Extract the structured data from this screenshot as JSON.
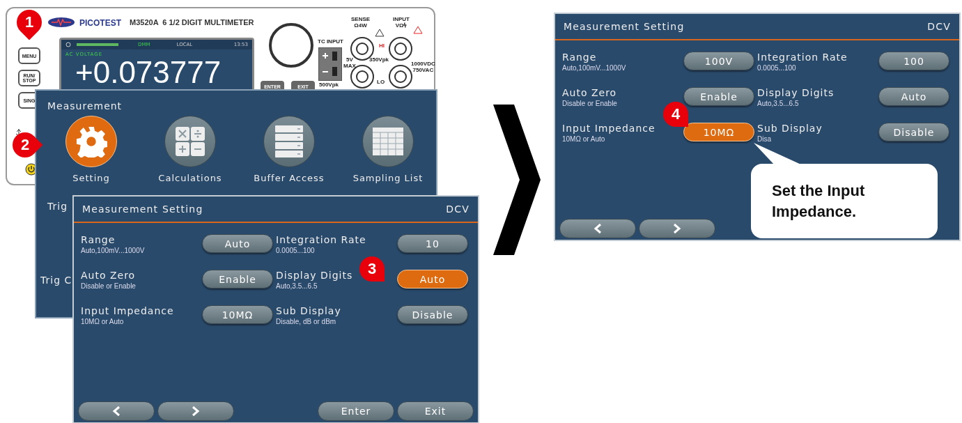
{
  "device": {
    "brand": "PICOTEST",
    "model": "M3520A  6 1/2 DIGIT MULTIMETER",
    "side_buttons": [
      {
        "label": "MENU"
      },
      {
        "label": "RUN/\nSTOP"
      },
      {
        "label": "SING"
      }
    ],
    "status": {
      "mode": "DMM",
      "source": "LOCAL",
      "time": "13:53"
    },
    "function": "AC VOLTAGE",
    "reading": "+0.073777",
    "keys": [
      "ENTER",
      "EXIT"
    ],
    "tc_input": {
      "label": "TC INPUT",
      "limit": "5V\nMAX"
    },
    "terminals": {
      "sense": "SENSE\nΩ4W",
      "input": "INPUT\nVΩ⫩",
      "hi": "HI",
      "lo": "LO",
      "sense_rating": "350Vpk",
      "input_rating": "1000VDC\n750VAC",
      "tc_rating": "500Vpk"
    }
  },
  "menu": {
    "title": "Measurement",
    "items": [
      {
        "label": "Setting",
        "kind": "gear",
        "selected": true
      },
      {
        "label": "Calculations",
        "kind": "calc",
        "selected": false
      },
      {
        "label": "Buffer Access",
        "kind": "buffer",
        "selected": false
      },
      {
        "label": "Sampling List",
        "kind": "table",
        "selected": false
      }
    ],
    "partial_labels": [
      "Trig",
      "Trig C"
    ]
  },
  "screens": [
    {
      "title": "Measurement Setting",
      "mode": "DCV",
      "settings": [
        {
          "label": "Range",
          "hint": "Auto,100mV...1000V",
          "value": "Auto",
          "selected": false
        },
        {
          "label": "Integration Rate",
          "hint": "0.0005...100",
          "value": "10",
          "selected": false
        },
        {
          "label": "Auto Zero",
          "hint": "Disable or Enable",
          "value": "Enable",
          "selected": false
        },
        {
          "label": "Display Digits",
          "hint": "Auto,3.5...6.5",
          "value": "Auto",
          "selected": true
        },
        {
          "label": "Input Impedance",
          "hint": "10MΩ or Auto",
          "value": "10MΩ",
          "selected": false
        },
        {
          "label": "Sub Display",
          "hint": "Disable, dB or dBm",
          "value": "Disable",
          "selected": false
        }
      ],
      "actions": [
        "Enter",
        "Exit"
      ]
    },
    {
      "title": "Measurement Setting",
      "mode": "DCV",
      "settings": [
        {
          "label": "Range",
          "hint": "Auto,100mV...1000V",
          "value": "100V",
          "selected": false
        },
        {
          "label": "Integration Rate",
          "hint": "0.0005...100",
          "value": "100",
          "selected": false
        },
        {
          "label": "Auto Zero",
          "hint": "Disable or Enable",
          "value": "Enable",
          "selected": false
        },
        {
          "label": "Display Digits",
          "hint": "Auto,3.5...6.5",
          "value": "Auto",
          "selected": false
        },
        {
          "label": "Input Impedance",
          "hint": "10MΩ or Auto",
          "value": "10MΩ",
          "selected": true
        },
        {
          "label": "Sub Display",
          "hint": "Disa",
          "value": "Disable",
          "selected": false
        }
      ]
    }
  ],
  "step_markers": [
    "1",
    "2",
    "3",
    "4"
  ],
  "callout": {
    "text": "Set the Input Impedance."
  }
}
